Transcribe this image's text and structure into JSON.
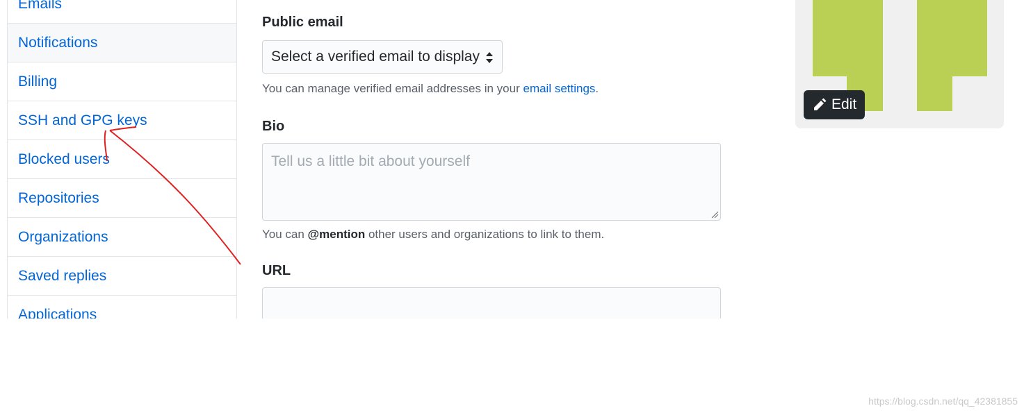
{
  "sidebar": {
    "items": [
      {
        "label": "Emails"
      },
      {
        "label": "Notifications"
      },
      {
        "label": "Billing"
      },
      {
        "label": "SSH and GPG keys"
      },
      {
        "label": "Blocked users"
      },
      {
        "label": "Repositories"
      },
      {
        "label": "Organizations"
      },
      {
        "label": "Saved replies"
      },
      {
        "label": "Applications"
      }
    ]
  },
  "form": {
    "public_email": {
      "label": "Public email",
      "selected": "Select a verified email to display",
      "note_prefix": "You can manage verified email addresses in your ",
      "note_link": "email settings",
      "note_suffix": "."
    },
    "bio": {
      "label": "Bio",
      "placeholder": "Tell us a little bit about yourself",
      "note_prefix": "You can ",
      "note_mention": "@mention",
      "note_suffix": " other users and organizations to link to them."
    },
    "url": {
      "label": "URL",
      "value": ""
    }
  },
  "avatar": {
    "edit_label": "Edit",
    "colors": {
      "background": "#f0f0f0",
      "identicon": "#b9d054"
    }
  },
  "annotation": {
    "color": "#e02020"
  },
  "watermark": "https://blog.csdn.net/qq_42381855"
}
